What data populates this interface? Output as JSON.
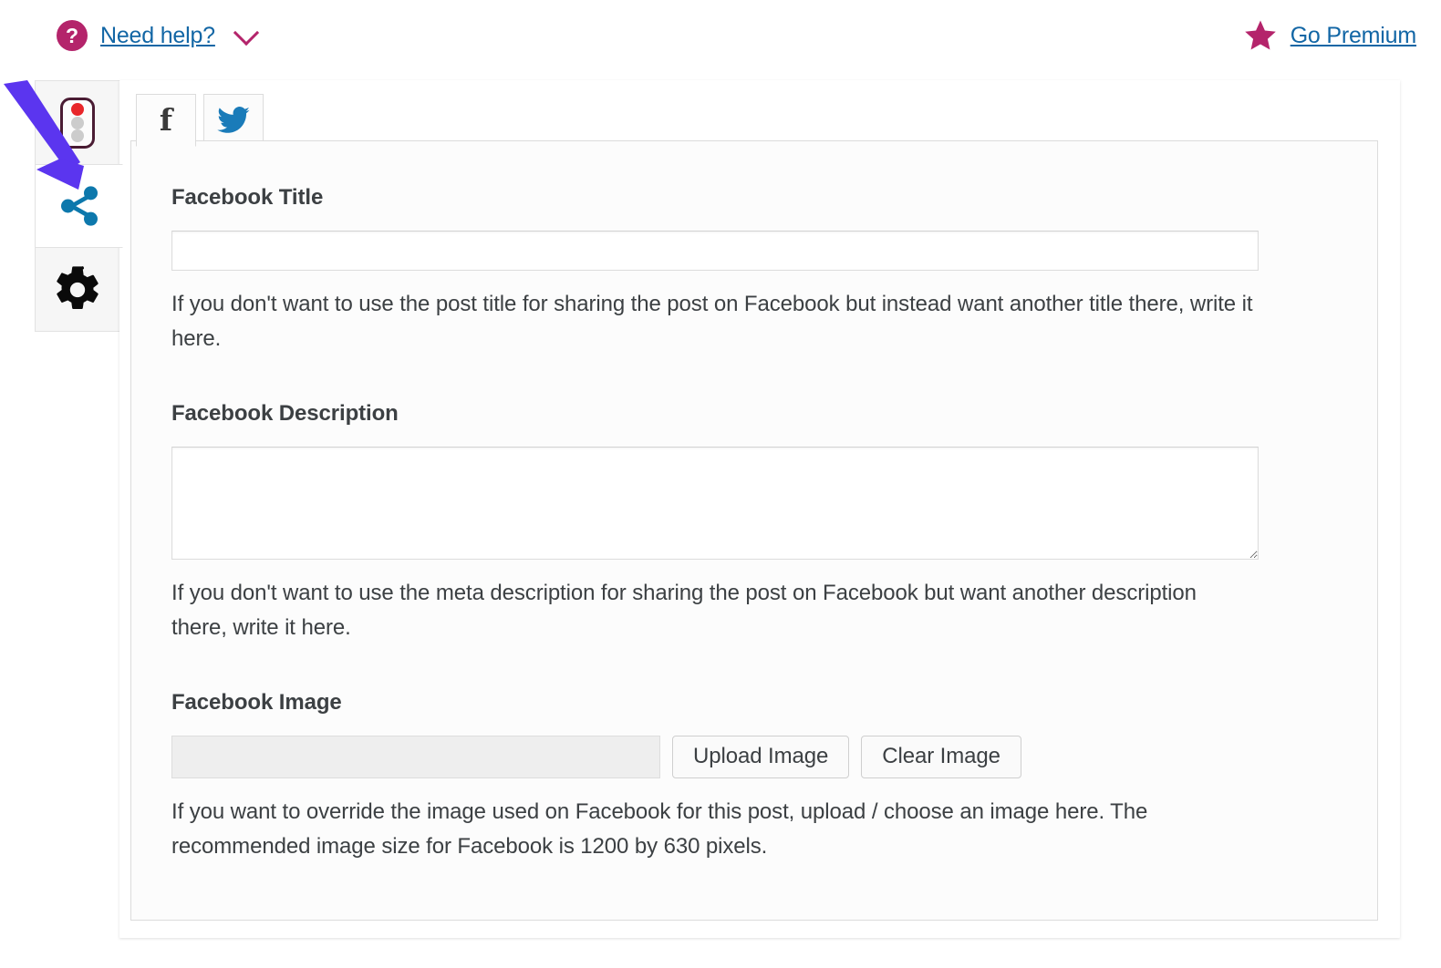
{
  "topbar": {
    "help_icon": "question-mark-circle-icon",
    "help_label": "Need help?",
    "help_chevron": "chevron-down-icon",
    "premium_icon": "star-icon",
    "premium_label": "Go Premium",
    "link_color": "#1266a5",
    "accent_color": "#b4246b"
  },
  "rail": {
    "items": [
      {
        "name": "traffic-light",
        "icon": "traffic-light-icon",
        "active": false
      },
      {
        "name": "social",
        "icon": "share-icon",
        "active": true
      },
      {
        "name": "settings",
        "icon": "gear-icon",
        "active": false
      }
    ],
    "share_icon_color": "#0d78ac",
    "traffic_light_border": "#4a1c33",
    "traffic_light_red": "#e8262a",
    "traffic_light_off": "#cccccc"
  },
  "tabs": [
    {
      "label": "f",
      "icon": "facebook-icon",
      "active": true
    },
    {
      "label": "",
      "icon": "twitter-icon",
      "active": false
    }
  ],
  "twitter_blue": "#1a7bb9",
  "form": {
    "title": {
      "label": "Facebook Title",
      "value": "",
      "placeholder": "",
      "help": "If you don't want to use the post title for sharing the post on Facebook but instead want another title there, write it here."
    },
    "description": {
      "label": "Facebook Description",
      "value": "",
      "placeholder": "",
      "help": "If you don't want to use the meta description for sharing the post on Facebook but want another description there, write it here."
    },
    "image": {
      "label": "Facebook Image",
      "value": "",
      "placeholder": "",
      "upload_label": "Upload Image",
      "clear_label": "Clear Image",
      "help": "If you want to override the image used on Facebook for this post, upload / choose an image here. The recommended image size for Facebook is 1200 by 630 pixels."
    }
  },
  "annotation": {
    "arrow_color": "#5b35ef",
    "points_at": "share-icon"
  }
}
